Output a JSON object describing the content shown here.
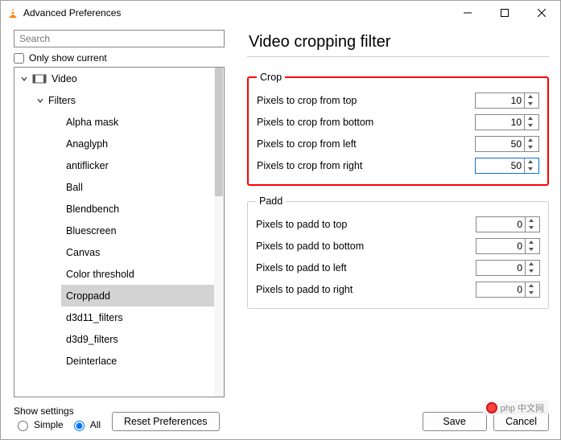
{
  "window": {
    "title": "Advanced Preferences"
  },
  "search": {
    "placeholder": "Search"
  },
  "only_current": {
    "label": "Only show current",
    "checked": false
  },
  "tree": {
    "video": {
      "label": "Video"
    },
    "filters": {
      "label": "Filters"
    },
    "items": [
      {
        "label": "Alpha mask"
      },
      {
        "label": "Anaglyph"
      },
      {
        "label": "antiflicker"
      },
      {
        "label": "Ball"
      },
      {
        "label": "Blendbench"
      },
      {
        "label": "Bluescreen"
      },
      {
        "label": "Canvas"
      },
      {
        "label": "Color threshold"
      },
      {
        "label": "Croppadd"
      },
      {
        "label": "d3d11_filters"
      },
      {
        "label": "d3d9_filters"
      },
      {
        "label": "Deinterlace"
      }
    ],
    "selected_index": 8
  },
  "panel": {
    "title": "Video cropping filter",
    "crop": {
      "legend": "Crop",
      "rows": [
        {
          "label": "Pixels to crop from top",
          "value": "10"
        },
        {
          "label": "Pixels to crop from bottom",
          "value": "10"
        },
        {
          "label": "Pixels to crop from left",
          "value": "50"
        },
        {
          "label": "Pixels to crop from right",
          "value": "50"
        }
      ]
    },
    "padd": {
      "legend": "Padd",
      "rows": [
        {
          "label": "Pixels to padd to top",
          "value": "0"
        },
        {
          "label": "Pixels to padd to bottom",
          "value": "0"
        },
        {
          "label": "Pixels to padd to left",
          "value": "0"
        },
        {
          "label": "Pixels to padd to right",
          "value": "0"
        }
      ]
    }
  },
  "footer": {
    "show_label": "Show settings",
    "simple": "Simple",
    "all": "All",
    "reset": "Reset Preferences",
    "save": "Save",
    "cancel": "Cancel"
  },
  "watermark": "php 中文网"
}
